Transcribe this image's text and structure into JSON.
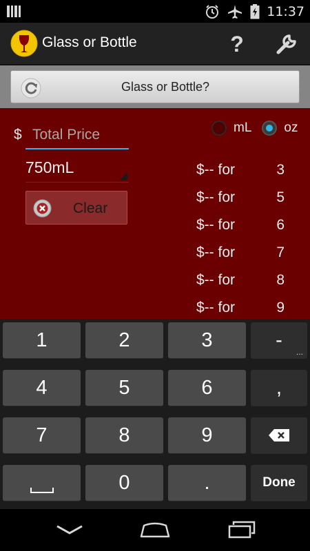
{
  "status_bar": {
    "time": "11:37",
    "icons": [
      "signal-bars-icon",
      "alarm-icon",
      "airplane-icon",
      "battery-charging-icon"
    ]
  },
  "action_bar": {
    "title": "Glass or Bottle",
    "help_icon": "question-mark-icon",
    "help_label": "?",
    "settings_icon": "wrench-icon"
  },
  "toolbar": {
    "button_label": "Glass or Bottle?",
    "button_icon": "refresh-icon"
  },
  "form": {
    "currency_symbol": "$",
    "price_placeholder": "Total Price",
    "price_value": "",
    "volume_selected": "750mL",
    "clear_label": "Clear",
    "clear_icon": "clear-x-icon"
  },
  "units": [
    {
      "label": "mL",
      "checked": false
    },
    {
      "label": "oz",
      "checked": true
    }
  ],
  "results": [
    {
      "text": "$-- for",
      "amount": "3"
    },
    {
      "text": "$-- for",
      "amount": "5"
    },
    {
      "text": "$-- for",
      "amount": "6"
    },
    {
      "text": "$-- for",
      "amount": "7"
    },
    {
      "text": "$-- for",
      "amount": "8"
    },
    {
      "text": "$-- for",
      "amount": "9"
    }
  ],
  "keyboard": {
    "rows": [
      [
        "1",
        "2",
        "3",
        "-"
      ],
      [
        "4",
        "5",
        "6",
        ","
      ],
      [
        "7",
        "8",
        "9",
        "backspace"
      ],
      [
        "space",
        "0",
        ".",
        "Done"
      ]
    ],
    "done_label": "Done"
  },
  "nav_bar": {
    "icons": [
      "back-icon",
      "home-icon",
      "recent-apps-icon"
    ]
  },
  "colors": {
    "panel_red": "#6b0000",
    "accent_blue": "#33b5e5",
    "toolbar_gray": "#858585"
  }
}
